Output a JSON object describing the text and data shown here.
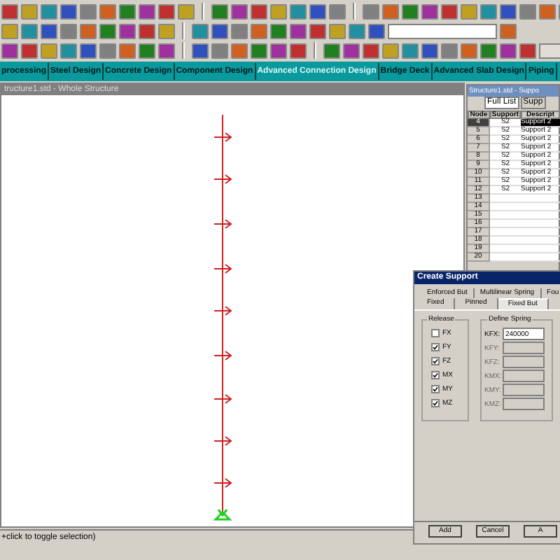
{
  "tabs": [
    {
      "label": "processing",
      "selected": false
    },
    {
      "label": "Steel Design",
      "selected": false
    },
    {
      "label": "Concrete Design",
      "selected": false
    },
    {
      "label": "Component Design",
      "selected": false
    },
    {
      "label": "Advanced Connection Design",
      "selected": true
    },
    {
      "label": "Bridge Deck",
      "selected": false
    },
    {
      "label": "Advanced Slab Design",
      "selected": false
    },
    {
      "label": "Piping",
      "selected": false
    }
  ],
  "view_window": {
    "title": "tructure1.std - Whole Structure"
  },
  "table_window": {
    "title": "Structure1.std - Suppo",
    "tabs": [
      {
        "label": "Full List",
        "selected": true
      },
      {
        "label": "Supp",
        "selected": false
      }
    ],
    "columns": [
      "Node",
      "Support",
      "Descript"
    ],
    "rows": [
      {
        "node": "4",
        "support": "S2",
        "description": "Support 2",
        "selected": true
      },
      {
        "node": "5",
        "support": "S2",
        "description": "Support 2",
        "selected": false
      },
      {
        "node": "6",
        "support": "S2",
        "description": "Support 2",
        "selected": false
      },
      {
        "node": "7",
        "support": "S2",
        "description": "Support 2",
        "selected": false
      },
      {
        "node": "8",
        "support": "S2",
        "description": "Support 2",
        "selected": false
      },
      {
        "node": "9",
        "support": "S2",
        "description": "Support 2",
        "selected": false
      },
      {
        "node": "10",
        "support": "S2",
        "description": "Support 2",
        "selected": false
      },
      {
        "node": "11",
        "support": "S2",
        "description": "Support 2",
        "selected": false
      },
      {
        "node": "12",
        "support": "S2",
        "description": "Support 2",
        "selected": false
      },
      {
        "node": "13",
        "selected": false
      },
      {
        "node": "14",
        "selected": false
      },
      {
        "node": "15",
        "selected": false
      },
      {
        "node": "16",
        "selected": false
      },
      {
        "node": "17",
        "selected": false
      },
      {
        "node": "18",
        "selected": false
      },
      {
        "node": "19",
        "selected": false
      },
      {
        "node": "20",
        "selected": false
      }
    ]
  },
  "dialog": {
    "title": "Create Support",
    "tabs_row_1": [
      {
        "label": "Enforced But",
        "selected": false
      },
      {
        "label": "Multilinear Spring",
        "selected": false
      },
      {
        "label": "Fou",
        "selected": false
      }
    ],
    "tabs_row_2": [
      {
        "label": "Fixed",
        "selected": false
      },
      {
        "label": "Pinned",
        "selected": false
      },
      {
        "label": "Fixed But",
        "selected": true
      }
    ],
    "release": {
      "title": "Release",
      "items": [
        {
          "label": "FX",
          "checked": false
        },
        {
          "label": "FY",
          "checked": true
        },
        {
          "label": "FZ",
          "checked": true
        },
        {
          "label": "MX",
          "checked": true
        },
        {
          "label": "MY",
          "checked": true
        },
        {
          "label": "MZ",
          "checked": true
        }
      ]
    },
    "spring": {
      "title": "Define Spring",
      "fields": [
        {
          "label": "KFX:",
          "value": "240000",
          "disabled": false
        },
        {
          "label": "KFY:",
          "disabled": true
        },
        {
          "label": "KFZ:",
          "disabled": true
        },
        {
          "label": "KMX:",
          "disabled": true
        },
        {
          "label": "KMY:",
          "disabled": true
        },
        {
          "label": "KMZ:",
          "disabled": true
        }
      ]
    },
    "buttons": [
      "Add",
      "Cancel",
      "A"
    ]
  },
  "status_bar": {
    "text": "+click to toggle selection)"
  }
}
